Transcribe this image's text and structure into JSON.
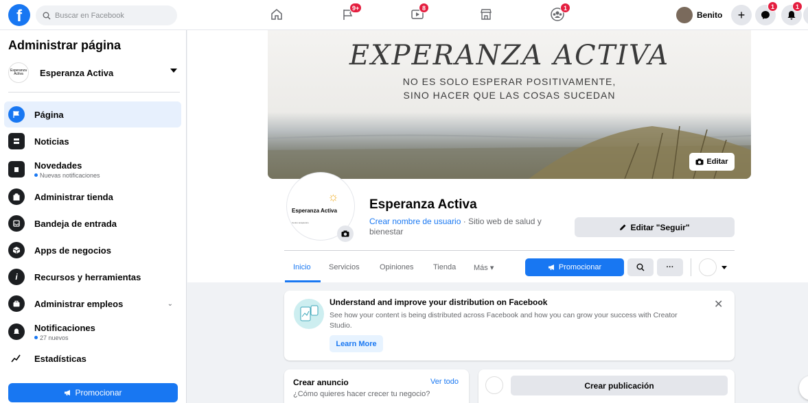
{
  "topbar": {
    "logo_letter": "f",
    "search_placeholder": "Buscar en Facebook",
    "badges": {
      "pages": "9+",
      "watch": "8",
      "groups": "1",
      "messenger": "1",
      "notifications": "1"
    },
    "user_name": "Benito",
    "plus": "+"
  },
  "sidebar": {
    "title": "Administrar página",
    "page_name": "Esperanza Activa",
    "page_avatar_text": "Esperanza Activa",
    "items": [
      {
        "label": "Página",
        "icon": "flag-icon"
      },
      {
        "label": "Noticias",
        "icon": "news-icon"
      },
      {
        "label": "Novedades",
        "sub": "Nuevas notificaciones",
        "icon": "updates-icon"
      },
      {
        "label": "Administrar tienda",
        "icon": "shop-icon"
      },
      {
        "label": "Bandeja de entrada",
        "icon": "inbox-icon"
      },
      {
        "label": "Apps de negocios",
        "icon": "apps-icon"
      },
      {
        "label": "Recursos y herramientas",
        "icon": "info-icon"
      },
      {
        "label": "Administrar empleos",
        "icon": "briefcase-icon",
        "chevron": "⌄"
      },
      {
        "label": "Notificaciones",
        "sub": "27 nuevos",
        "icon": "bell-icon"
      },
      {
        "label": "Estadísticas",
        "icon": "chart-icon"
      }
    ],
    "promote_label": "Promocionar"
  },
  "cover": {
    "title": "EXPERANZA ACTIVA",
    "line1": "NO ES SOLO ESPERAR POSITIVAMENTE,",
    "line2": "SINO HACER QUE LAS COSAS SUCEDAN",
    "edit_label": "Editar"
  },
  "profile": {
    "pic_text": "Esperanza Activa",
    "pic_small": "Centro terapéutico",
    "name": "Esperanza Activa",
    "username_link": "Crear nombre de usuario",
    "category": " · Sitio web de salud y bienestar",
    "edit_follow_label": "Editar \"Seguir\""
  },
  "tabs": [
    {
      "label": "Inicio",
      "active": true
    },
    {
      "label": "Servicios"
    },
    {
      "label": "Opiniones"
    },
    {
      "label": "Tienda"
    },
    {
      "label": "Más ▾"
    }
  ],
  "actions": {
    "promote_label": "Promocionar",
    "more": "···"
  },
  "distribution_card": {
    "title": "Understand and improve your distribution on Facebook",
    "text": "See how your content is being distributed across Facebook and how you can grow your success with Creator Studio.",
    "button": "Learn More",
    "close": "✕"
  },
  "ad_card": {
    "title": "Crear anuncio",
    "link": "Ver todo",
    "sub": "¿Cómo quieres hacer crecer tu negocio?"
  },
  "post_card": {
    "button": "Crear publicación"
  },
  "colors": {
    "accent": "#1877f2",
    "badge": "#e41e3f",
    "background": "#f0f2f5"
  }
}
